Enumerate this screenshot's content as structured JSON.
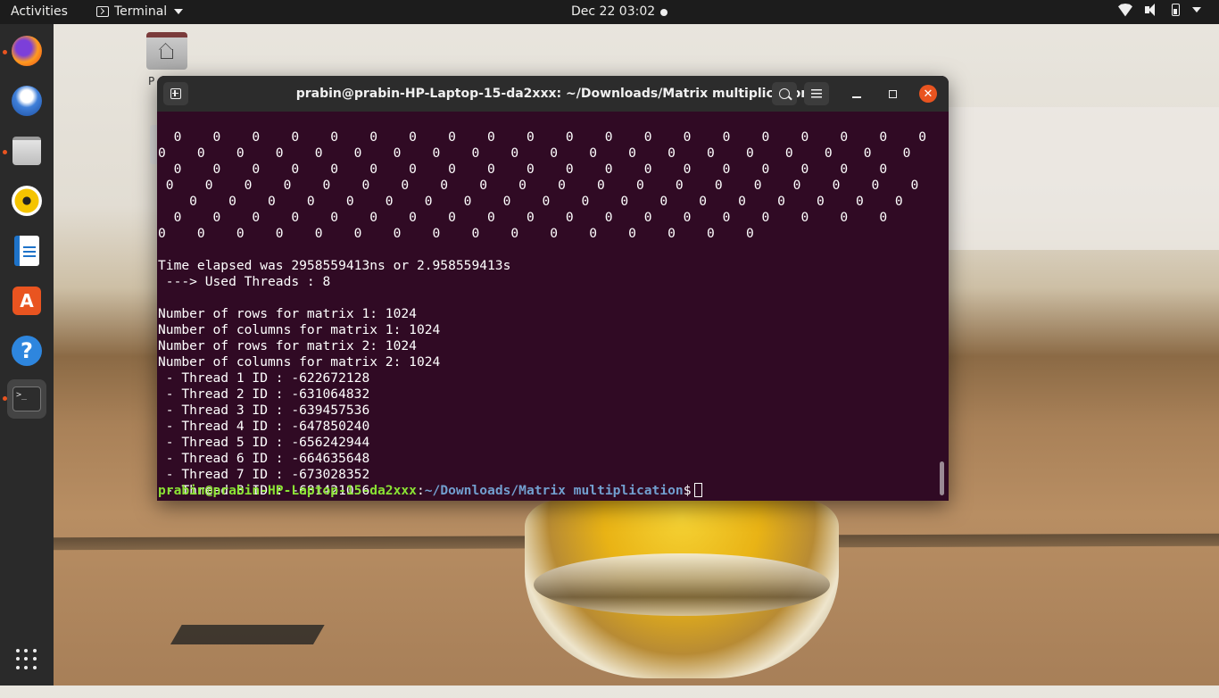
{
  "topbar": {
    "activities": "Activities",
    "app_name": "Terminal",
    "clock": "Dec 22  03:02"
  },
  "dock": {
    "items": [
      "firefox-icon",
      "thunderbird-icon",
      "files-icon",
      "rhythmbox-icon",
      "libreoffice-writer-icon",
      "ubuntu-software-icon",
      "help-icon",
      "terminal-icon"
    ],
    "software_glyph": "A",
    "help_glyph": "?",
    "terminal_glyph": ">_"
  },
  "desktop": {
    "home_label": "P"
  },
  "terminal": {
    "title": "prabin@prabin-HP-Laptop-15-da2xxx: ~/Downloads/Matrix multiplication",
    "zero_rows": [
      "  0    0    0    0    0    0    0    0    0    0    0    0    0    0    0    0    0    0    0    0",
      "0    0    0    0    0    0    0    0    0    0    0    0    0    0    0    0    0    0    0    0",
      "  0    0    0    0    0    0    0    0    0    0    0    0    0    0    0    0    0    0    0",
      " 0    0    0    0    0    0    0    0    0    0    0    0    0    0    0    0    0    0    0    0",
      "    0    0    0    0    0    0    0    0    0    0    0    0    0    0    0    0    0    0    0",
      "  0    0    0    0    0    0    0    0    0    0    0    0    0    0    0    0    0    0    0",
      "0    0    0    0    0    0    0    0    0    0    0    0    0    0    0    0"
    ],
    "time_line": "Time elapsed was 2958559413ns or 2.958559413s",
    "threads_line": " ---> Used Threads : 8",
    "info_lines": [
      "Number of rows for matrix 1: 1024",
      "Number of columns for matrix 1: 1024",
      "Number of rows for matrix 2: 1024",
      "Number of columns for matrix 2: 1024"
    ],
    "thread_lines": [
      " - Thread 1 ID : -622672128",
      " - Thread 2 ID : -631064832",
      " - Thread 3 ID : -639457536",
      " - Thread 4 ID : -647850240",
      " - Thread 5 ID : -656242944",
      " - Thread 6 ID : -664635648",
      " - Thread 7 ID : -673028352",
      " - Thread 8 ID : -681421056"
    ],
    "prompt": {
      "user_host": "prabin@prabin-HP-Laptop-15-da2xxx",
      "colon": ":",
      "path": "~/Downloads/Matrix multiplication",
      "dollar": "$"
    }
  },
  "colors": {
    "terminal_bg": "#300a24",
    "prompt_user": "#8ae234",
    "prompt_path": "#729fcf",
    "accent": "#e95420"
  }
}
